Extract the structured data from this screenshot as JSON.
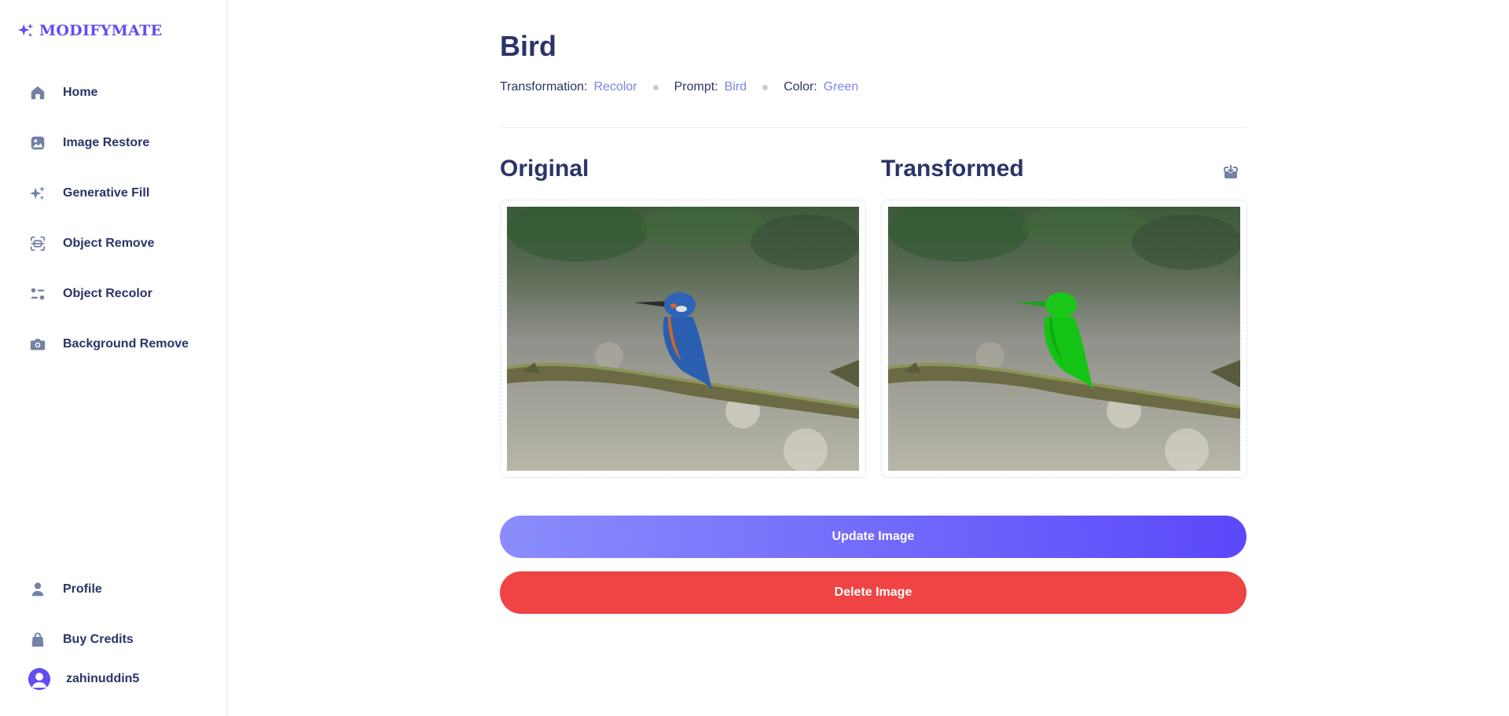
{
  "app": {
    "name": "MODIFYMATE",
    "accent": "#624cf5"
  },
  "sidebar": {
    "items": [
      {
        "label": "Home",
        "icon": "home-icon"
      },
      {
        "label": "Image Restore",
        "icon": "image-icon"
      },
      {
        "label": "Generative Fill",
        "icon": "sparkles-icon"
      },
      {
        "label": "Object Remove",
        "icon": "scan-icon"
      },
      {
        "label": "Object Recolor",
        "icon": "filter-icon"
      },
      {
        "label": "Background Remove",
        "icon": "camera-icon"
      }
    ],
    "bottom_items": [
      {
        "label": "Profile",
        "icon": "user-icon"
      },
      {
        "label": "Buy Credits",
        "icon": "bag-icon"
      }
    ],
    "user": {
      "name": "zahinuddin5"
    }
  },
  "page": {
    "title": "Bird",
    "meta": {
      "transformation_label": "Transformation:",
      "transformation_value": "Recolor",
      "prompt_label": "Prompt:",
      "prompt_value": "Bird",
      "color_label": "Color:",
      "color_value": "Green"
    }
  },
  "panels": {
    "original_title": "Original",
    "transformed_title": "Transformed"
  },
  "actions": {
    "update_label": "Update Image",
    "delete_label": "Delete Image",
    "update_color": "#5b48fa",
    "delete_color": "#ef4344"
  }
}
